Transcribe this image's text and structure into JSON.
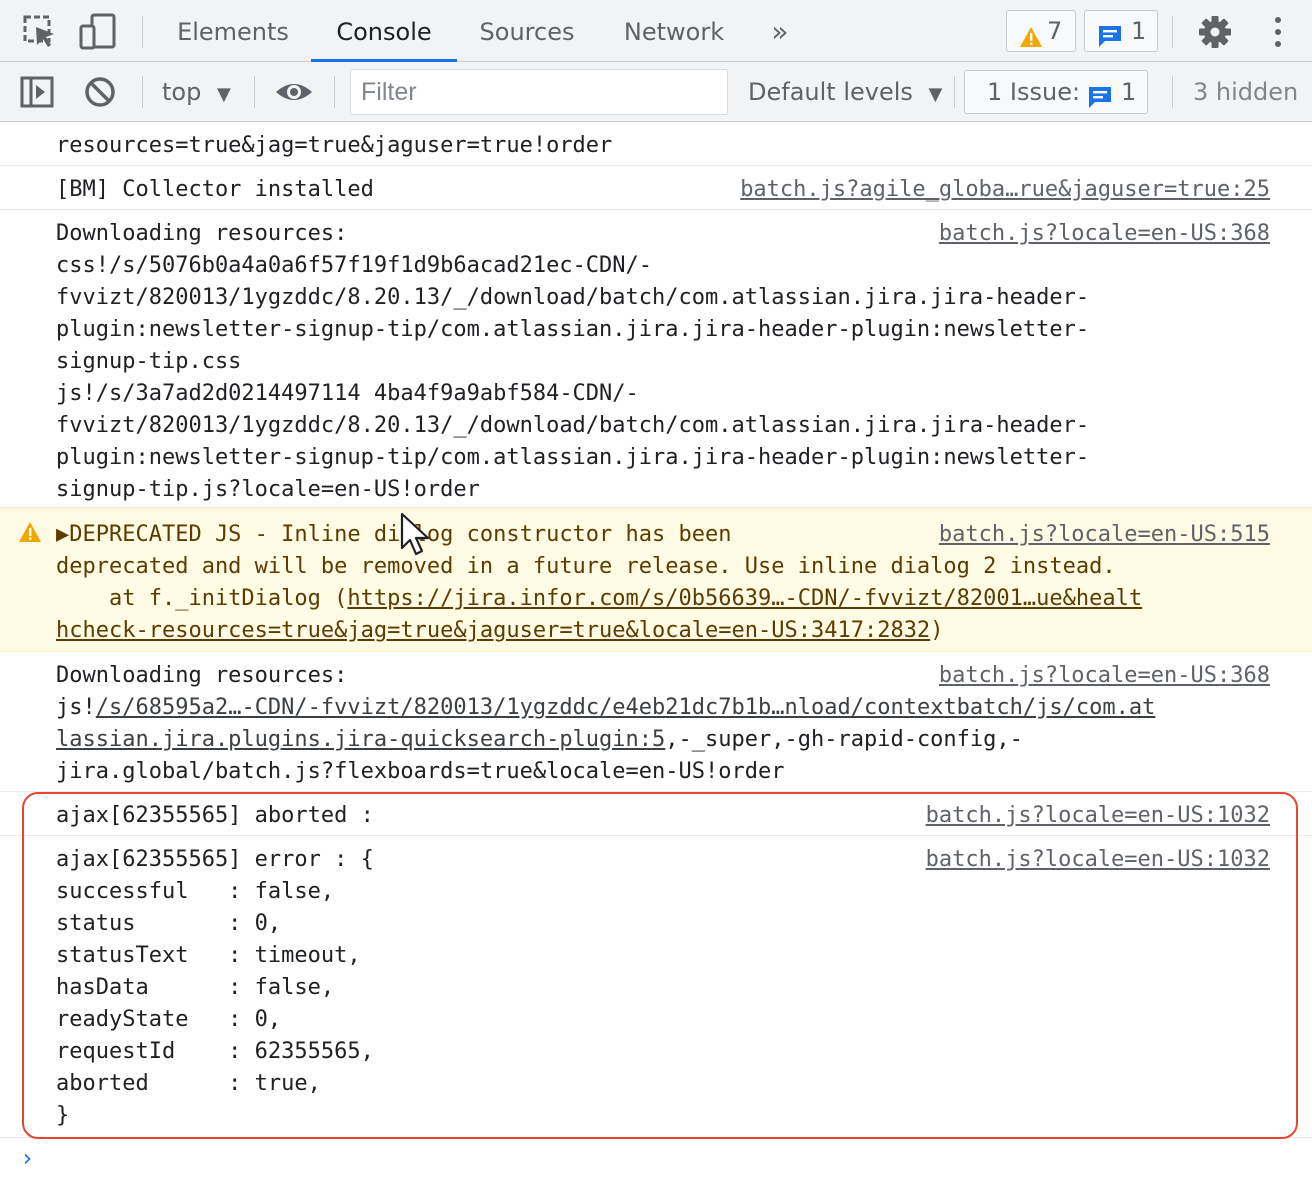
{
  "tabs": {
    "items": [
      {
        "label": "Elements",
        "active": false
      },
      {
        "label": "Console",
        "active": true
      },
      {
        "label": "Sources",
        "active": false
      },
      {
        "label": "Network",
        "active": false
      }
    ],
    "more_label": "»",
    "warnings_count": "7",
    "messages_count": "1"
  },
  "toolbar": {
    "context": "top",
    "filter_placeholder": "Filter",
    "levels_label": "Default levels",
    "issues_label": "1 Issue:",
    "issues_count": "1",
    "hidden_label": "3 hidden"
  },
  "console": {
    "messages": [
      {
        "type": "log",
        "lines": [
          "resources=true&jag=true&jaguser=true!order"
        ]
      },
      {
        "type": "log",
        "lines": [
          "[BM] Collector installed"
        ],
        "source": "batch.js?agile_globa…rue&jaguser=true:25"
      },
      {
        "type": "log",
        "lines": [
          "Downloading resources:",
          "css!/s/5076b0a4a0a6f57f19f1d9b6acad21ec-CDN/-",
          "fvvizt/820013/1ygzddc/8.20.13/_/download/batch/com.atlassian.jira.jira-header-",
          "plugin:newsletter-signup-tip/com.atlassian.jira.jira-header-plugin:newsletter-",
          "signup-tip.css",
          "js!/s/3a7ad2d0214497114 4ba4f9a9abf584-CDN/-",
          "fvvizt/820013/1ygzddc/8.20.13/_/download/batch/com.atlassian.jira.jira-header-",
          "plugin:newsletter-signup-tip/com.atlassian.jira.jira-header-plugin:newsletter-",
          "signup-tip.js?locale=en-US!order"
        ],
        "source": "batch.js?locale=en-US:368"
      },
      {
        "type": "warning",
        "lines": [
          "▶DEPRECATED JS - Inline dialog constructor has been",
          "deprecated and will be removed in a future release. Use inline dialog 2 instead.",
          "    at f._initDialog (",
          ")"
        ],
        "link_line1": "https://jira.infor.com/s/0b56639…-CDN/-fvvizt/82001…ue&healt",
        "link_line2": "hcheck-resources=true&jag=true&jaguser=true&locale=en-US:3417:2832",
        "source": "batch.js?locale=en-US:515"
      },
      {
        "type": "log",
        "lines": [
          "Downloading resources:",
          "js!",
          ",-_super,-gh-rapid-config,-",
          "jira.global/batch.js?flexboards=true&locale=en-US!order"
        ],
        "link_line1": "/s/68595a2…-CDN/-fvvizt/820013/1ygzddc/e4eb21dc7b1b…nload/contextbatch/js/com.at",
        "link_line2": "lassian.jira.plugins.jira-quicksearch-plugin:5",
        "source": "batch.js?locale=en-US:368"
      },
      {
        "type": "log",
        "lines": [
          "ajax[62355565] aborted :"
        ],
        "source": "batch.js?locale=en-US:1032"
      },
      {
        "type": "log",
        "lines": [
          "ajax[62355565] error : {",
          "successful   : false,",
          "status       : 0,",
          "statusText   : timeout,",
          "hasData      : false,",
          "readyState   : 0,",
          "requestId    : 62355565,",
          "aborted      : true,",
          "}"
        ],
        "source": "batch.js?locale=en-US:1032"
      }
    ],
    "prompt": "›"
  },
  "colors": {
    "accent": "#1a73e8",
    "warning_bg": "#fffbe5",
    "warning_icon": "#f2a600",
    "highlight_border": "#e8452f"
  }
}
